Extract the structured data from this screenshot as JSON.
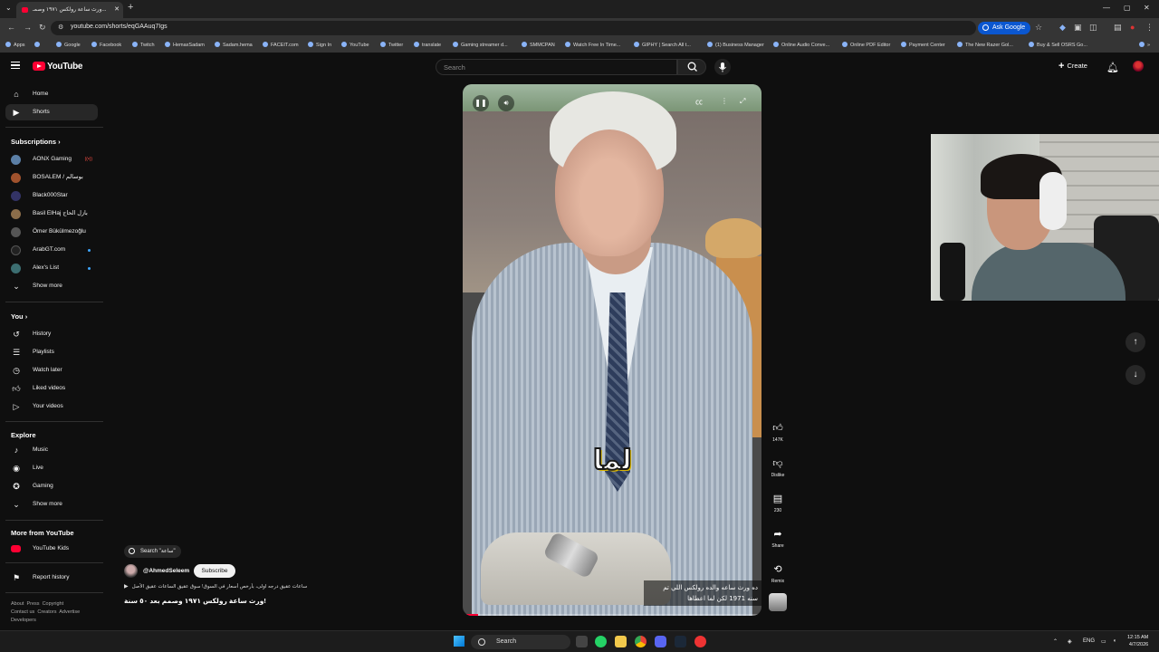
{
  "browser": {
    "tab_title": "ورث ساعة رولكس ١٩٧١ وصمـ...",
    "url": "youtube.com/shorts/eqGAAuq7Igs",
    "ask_google": "Ask Google",
    "bookmarks": [
      "Apps",
      "Google",
      "Facebook",
      "Twitch",
      "HemaxSadam",
      "Sadam.hema",
      "FACEIT.com",
      "Sign In",
      "YouTube",
      "Twitter",
      "translate",
      "Gaming streamer d...",
      "SMMCPAN",
      "Watch Free In Time...",
      "GIPHY | Search All t...",
      "(1) Business Manager",
      "Online Audio Conve...",
      "Online PDF Editor",
      "Payment Center",
      "The New Razer Gol...",
      "Buy & Sell OSRS Go..."
    ]
  },
  "masthead": {
    "logo_text": "YouTube",
    "search_placeholder": "Search",
    "create_label": "Create"
  },
  "sidebar": {
    "main": [
      {
        "label": "Home",
        "icon": "home-icon"
      },
      {
        "label": "Shorts",
        "icon": "shorts-icon",
        "active": true
      }
    ],
    "subscriptions_title": "Subscriptions",
    "subscriptions": [
      {
        "label": "AONX Gaming",
        "badge": "live",
        "color": "#5b7fa6"
      },
      {
        "label": "BOSALEM / بوسالم",
        "badge": "",
        "color": "#a0522d"
      },
      {
        "label": "Black000Star",
        "badge": "",
        "color": "#333366"
      },
      {
        "label": "Basil ElHaj بازل الحاج",
        "badge": "",
        "color": "#8b6d4a"
      },
      {
        "label": "Ömer Bükülmezoğlu",
        "badge": "",
        "color": "#555555"
      },
      {
        "label": "ArabGT.com",
        "badge": "dot",
        "color": "#222222"
      },
      {
        "label": "Alex's List",
        "badge": "dot",
        "color": "#3c6e71"
      }
    ],
    "show_more": "Show more",
    "you_title": "You",
    "you": [
      {
        "label": "History",
        "icon": "history-icon"
      },
      {
        "label": "Playlists",
        "icon": "playlists-icon"
      },
      {
        "label": "Watch later",
        "icon": "watch-later-icon"
      },
      {
        "label": "Liked videos",
        "icon": "liked-icon"
      },
      {
        "label": "Your videos",
        "icon": "your-videos-icon"
      }
    ],
    "explore_title": "Explore",
    "explore": [
      {
        "label": "Music",
        "icon": "music-icon"
      },
      {
        "label": "Live",
        "icon": "live-icon"
      },
      {
        "label": "Gaming",
        "icon": "gaming-icon"
      }
    ],
    "more_title": "More from YouTube",
    "youtube_kids": "YouTube Kids",
    "report_history": "Report history",
    "footer": [
      "About",
      "Press",
      "Copyright",
      "Contact us",
      "Creators",
      "Advertise",
      "Developers"
    ]
  },
  "short": {
    "caption_word": "لما",
    "subtitle_line1": "ده ورث ساعه والده رولكس اللي تم",
    "subtitle_line2": "سنه 1971 لكن لما اعطاها",
    "progress": 0.05,
    "search_chip": "Search \"ساعة\"",
    "channel": "@AhmedSeleem",
    "subscribe": "Subscribe",
    "description": "ساعات عقيق درجه اولى، بأرخص أسعار في السوق! سوق عقيق الساعات عقيق الأصل",
    "title": "ورث ساعة رولكس ١٩٧١ وصمم بعد ٥٠ سنة!"
  },
  "actions": {
    "like_count": "147K",
    "dislike_label": "Dislike",
    "comment_count": "230",
    "share_label": "Share",
    "remix_label": "Remix"
  },
  "taskbar": {
    "search": "Search",
    "lang": "ENG",
    "time": "12:15 AM",
    "date": "4/7/2026"
  }
}
